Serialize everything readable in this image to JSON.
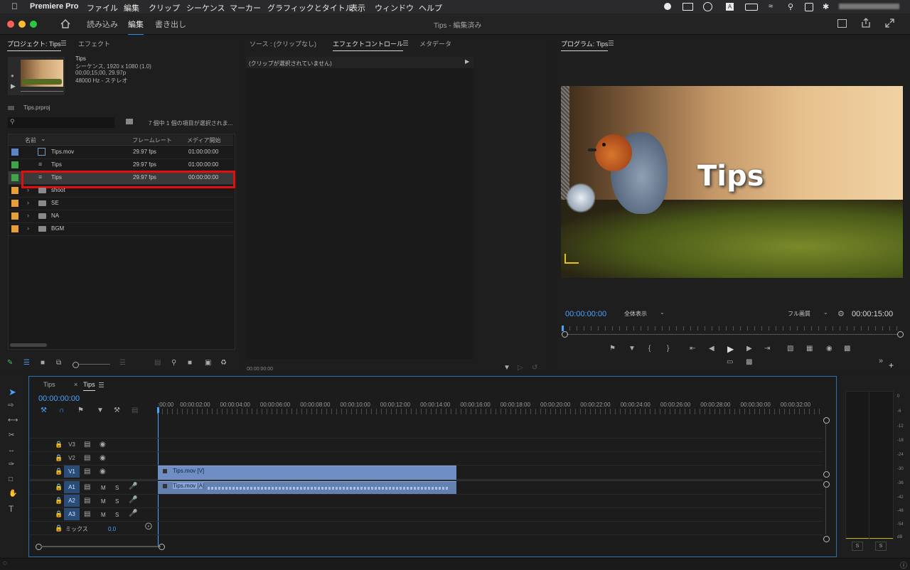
{
  "menubar": {
    "apple": "",
    "app_name": "Premiere Pro",
    "items": [
      "ファイル",
      "編集",
      "クリップ",
      "シーケンス",
      "マーカー",
      "グラフィックとタイトル",
      "表示",
      "ウィンドウ",
      "ヘルプ"
    ]
  },
  "header": {
    "workspaces": [
      "読み込み",
      "編集",
      "書き出し"
    ],
    "active_workspace": "編集",
    "window_title": "Tips - 編集済み"
  },
  "project": {
    "tab_label": "プロジェクト: Tips",
    "tab2_label": "エフェクト",
    "preview": {
      "name": "Tips",
      "line1": "シーケンス, 1920 x 1080 (1.0)",
      "line2": "00;00;15;00, 29.97p",
      "line3": "48000 Hz - ステレオ"
    },
    "file_name": "Tips.prproj",
    "search_placeholder": "",
    "selection_info": "7 個中 1 個の項目が選択されま...",
    "columns": [
      "名前",
      "フレームレート",
      "メディア開始"
    ],
    "rows": [
      {
        "name": "Tips.mov",
        "fps": "29.97 fps",
        "start": "01:00:00:00",
        "color": "#5b86c8",
        "type": "clip"
      },
      {
        "name": "Tips",
        "fps": "29.97 fps",
        "start": "01:00:00:00",
        "color": "#3ea54a",
        "type": "seq"
      },
      {
        "name": "Tips",
        "fps": "29.97 fps",
        "start": "00:00:00:00",
        "color": "#3ea54a",
        "type": "seq"
      },
      {
        "name": "shoot",
        "fps": "",
        "start": "",
        "color": "#e6a035",
        "type": "folder"
      },
      {
        "name": "SE",
        "fps": "",
        "start": "",
        "color": "#e6a035",
        "type": "folder"
      },
      {
        "name": "NA",
        "fps": "",
        "start": "",
        "color": "#e6a035",
        "type": "folder"
      },
      {
        "name": "BGM",
        "fps": "",
        "start": "",
        "color": "#e6a035",
        "type": "folder"
      }
    ]
  },
  "source": {
    "tab_source": "ソース : (クリップなし)",
    "tab_effects": "エフェクトコントロール",
    "tab_meta": "メタデータ",
    "no_clip": "(クリップが選択されていません)",
    "timecode": "00:00:00:00"
  },
  "program": {
    "tab_label": "プログラム: Tips",
    "title_text": "Tips",
    "timecode_current": "00:00:00:00",
    "zoom": "全体表示",
    "quality": "フル画質",
    "timecode_duration": "00:00:15:00"
  },
  "timeline": {
    "tab1": "Tips",
    "tab2": "Tips",
    "timecode": "00:00:00:00",
    "ruler": [
      ":00:00",
      "00:00:02:00",
      "00:00:04:00",
      "00:00:06:00",
      "00:00:08:00",
      "00:00:10:00",
      "00:00:12:00",
      "00:00:14:00",
      "00:00:16:00",
      "00:00:18:00",
      "00:00:20:00",
      "00:00:22:00",
      "00:00:24:00",
      "00:00:26:00",
      "00:00:28:00",
      "00:00:30:00",
      "00:00:32:00"
    ],
    "video_tracks": [
      "V3",
      "V2",
      "V1"
    ],
    "audio_tracks": [
      "A1",
      "A2",
      "A3"
    ],
    "mix_label": "ミックス",
    "mix_value": "0.0",
    "clip_v": "Tips.mov [V]",
    "clip_a": "Tips.mov [A]",
    "m_label": "M",
    "s_label": "S"
  },
  "meters": {
    "scale": [
      "0",
      "-6",
      "-12",
      "-18",
      "-24",
      "-30",
      "-36",
      "-42",
      "-48",
      "-54",
      "dB"
    ],
    "solo": [
      "S",
      "S"
    ]
  }
}
